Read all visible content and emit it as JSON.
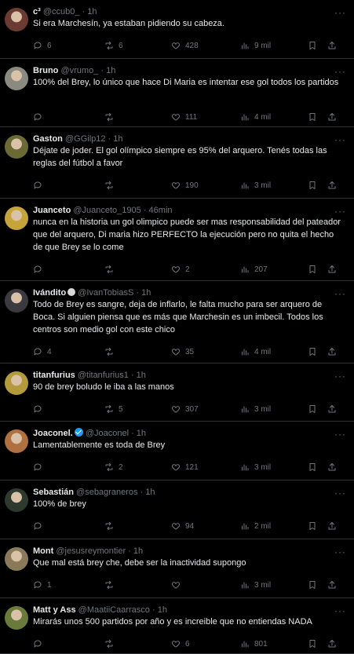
{
  "tweets": [
    {
      "name": "c³",
      "handle": "@ccub0_",
      "time": "1h",
      "verified": false,
      "emoji": false,
      "text": "Si era Marchesín, ya estaban pidiendo su cabeza.",
      "replies": "6",
      "retweets": "6",
      "likes": "428",
      "views": "9 mil",
      "avatar": "#6b3a32"
    },
    {
      "name": "Bruno",
      "handle": "@vrumo_",
      "time": "1h",
      "verified": false,
      "emoji": false,
      "text": "100% del Brey, lo único que hace Di Maria es intentar ese gol todos los partidos",
      "replies": "",
      "retweets": "",
      "likes": "111",
      "views": "4 mil",
      "avatar": "#8a8a80"
    },
    {
      "name": "Gaston",
      "handle": "@GGilp12",
      "time": "1h",
      "verified": false,
      "emoji": false,
      "text": "Déjate de joder. El gol olímpico siempre es 95% del arquero. Tenés todas las reglas del fútbol a favor",
      "replies": "",
      "retweets": "",
      "likes": "190",
      "views": "3 mil",
      "avatar": "#6a6a35"
    },
    {
      "name": "Juanceto",
      "handle": "@Juanceto_1905",
      "time": "46min",
      "verified": false,
      "emoji": false,
      "text": "nunca en la historia un gol olimpico puede ser mas responsabilidad del pateador que del arquero, Di maria hizo PERFECTO la ejecución pero no quita el hecho de que Brey se lo come",
      "replies": "",
      "retweets": "",
      "likes": "2",
      "views": "207",
      "avatar": "#c7a43a"
    },
    {
      "name": "Ivándito",
      "handle": "@IvanTobiasS",
      "time": "1h",
      "verified": false,
      "emoji": true,
      "text": "Todo de Brey es sangre, deja de inflarlo, le falta mucho para ser arquero de Boca. Si alguien piensa que es más que Marchesin es un imbecil. Todos los centros son medio gol con este chico",
      "replies": "4",
      "retweets": "",
      "likes": "35",
      "views": "4 mil",
      "avatar": "#3a3a40"
    },
    {
      "name": "titanfurius",
      "handle": "@titanfurius1",
      "time": "1h",
      "verified": false,
      "emoji": false,
      "text": "90 de brey boludo le iba a las manos",
      "replies": "",
      "retweets": "5",
      "likes": "307",
      "views": "3 mil",
      "avatar": "#b39a3a"
    },
    {
      "name": "Joaconel.",
      "handle": "@Joaconel",
      "time": "1h",
      "verified": true,
      "emoji": false,
      "text": "Lamentablemente es toda de Brey",
      "replies": "",
      "retweets": "2",
      "likes": "121",
      "views": "3 mil",
      "avatar": "#b07040"
    },
    {
      "name": "Sebastián",
      "handle": "@sebagraneros",
      "time": "1h",
      "verified": false,
      "emoji": false,
      "text": "100% de brey",
      "replies": "",
      "retweets": "",
      "likes": "94",
      "views": "2 mil",
      "avatar": "#2e3a2e"
    },
    {
      "name": "Mont",
      "handle": "@jesusreymontier",
      "time": "1h",
      "verified": false,
      "emoji": false,
      "text": "Que mal está brey che, debe ser la inactividad supongo",
      "replies": "1",
      "retweets": "",
      "likes": "",
      "views": "3 mil",
      "avatar": "#8a7a5a"
    },
    {
      "name": "Matt y Ass",
      "handle": "@MaatiiCaarrasco",
      "time": "1h",
      "verified": false,
      "emoji": false,
      "text": "Mirarás unos 500 partidos por año y es increible que no entiendas NADA",
      "replies": "",
      "retweets": "",
      "likes": "6",
      "views": "801",
      "avatar": "#6a7a3a"
    }
  ],
  "icons": {
    "reply": "reply-icon",
    "retweet": "retweet-icon",
    "like": "heart-icon",
    "views": "views-icon",
    "bookmark": "bookmark-icon",
    "share": "share-icon",
    "more": "more-icon"
  },
  "more_glyph": "···"
}
